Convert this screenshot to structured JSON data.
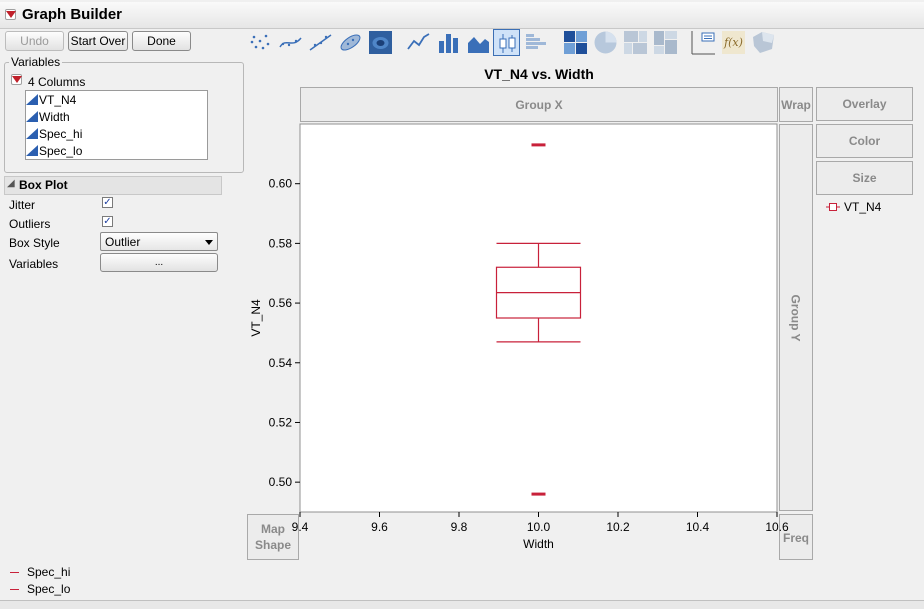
{
  "window": {
    "title": "Graph Builder"
  },
  "toolbar": {
    "undo_label": "Undo",
    "start_over_label": "Start Over",
    "done_label": "Done"
  },
  "variables": {
    "legend": "Variables",
    "columns_header": "4 Columns",
    "columns": [
      "VT_N4",
      "Width",
      "Spec_hi",
      "Spec_lo"
    ]
  },
  "box_plot": {
    "header": "Box Plot",
    "jitter_label": "Jitter",
    "jitter_checked": true,
    "outliers_label": "Outliers",
    "outliers_checked": true,
    "box_style_label": "Box Style",
    "box_style_value": "Outlier",
    "variables_label": "Variables",
    "variables_button": "..."
  },
  "graph_types": [
    "points-icon",
    "smoother-icon",
    "line-of-fit-icon",
    "ellipse-icon",
    "contour-icon",
    "line-icon",
    "bar-icon",
    "area-icon",
    "box-plot-icon",
    "histogram-icon",
    "heatmap-icon",
    "pie-icon",
    "treemap-icon",
    "mosaic-icon",
    "caption-box-icon",
    "formula-icon",
    "map-shapes-icon"
  ],
  "selected_graph_type": "box-plot-icon",
  "zones": {
    "group_x": "Group X",
    "group_y": "Group Y",
    "wrap": "Wrap",
    "overlay": "Overlay",
    "color": "Color",
    "size": "Size",
    "map_shape": [
      "Map",
      "Shape"
    ],
    "freq": "Freq"
  },
  "legend": {
    "overlay_item": "VT_N4",
    "bottom_items": [
      "Spec_hi",
      "Spec_lo"
    ]
  },
  "colors": {
    "series": "#c8213a",
    "accent": "#c0202a",
    "selected": "#3c6fb4"
  },
  "chart_data": {
    "type": "box",
    "title": "VT_N4 vs. Width",
    "xlabel": "Width",
    "ylabel": "VT_N4",
    "xlim": [
      9.4,
      10.6
    ],
    "ylim": [
      0.49,
      0.62
    ],
    "xticks": [
      "9.4",
      "9.6",
      "9.8",
      "10.0",
      "10.2",
      "10.4",
      "10.6"
    ],
    "yticks": [
      "0.50",
      "0.52",
      "0.54",
      "0.56",
      "0.58",
      "0.60"
    ],
    "series": [
      {
        "name": "VT_N4",
        "x": 10.0,
        "whisker_low": 0.547,
        "q1": 0.555,
        "median": 0.5635,
        "q3": 0.572,
        "whisker_high": 0.58,
        "reference_marks": [
          0.613,
          0.496
        ]
      }
    ]
  }
}
